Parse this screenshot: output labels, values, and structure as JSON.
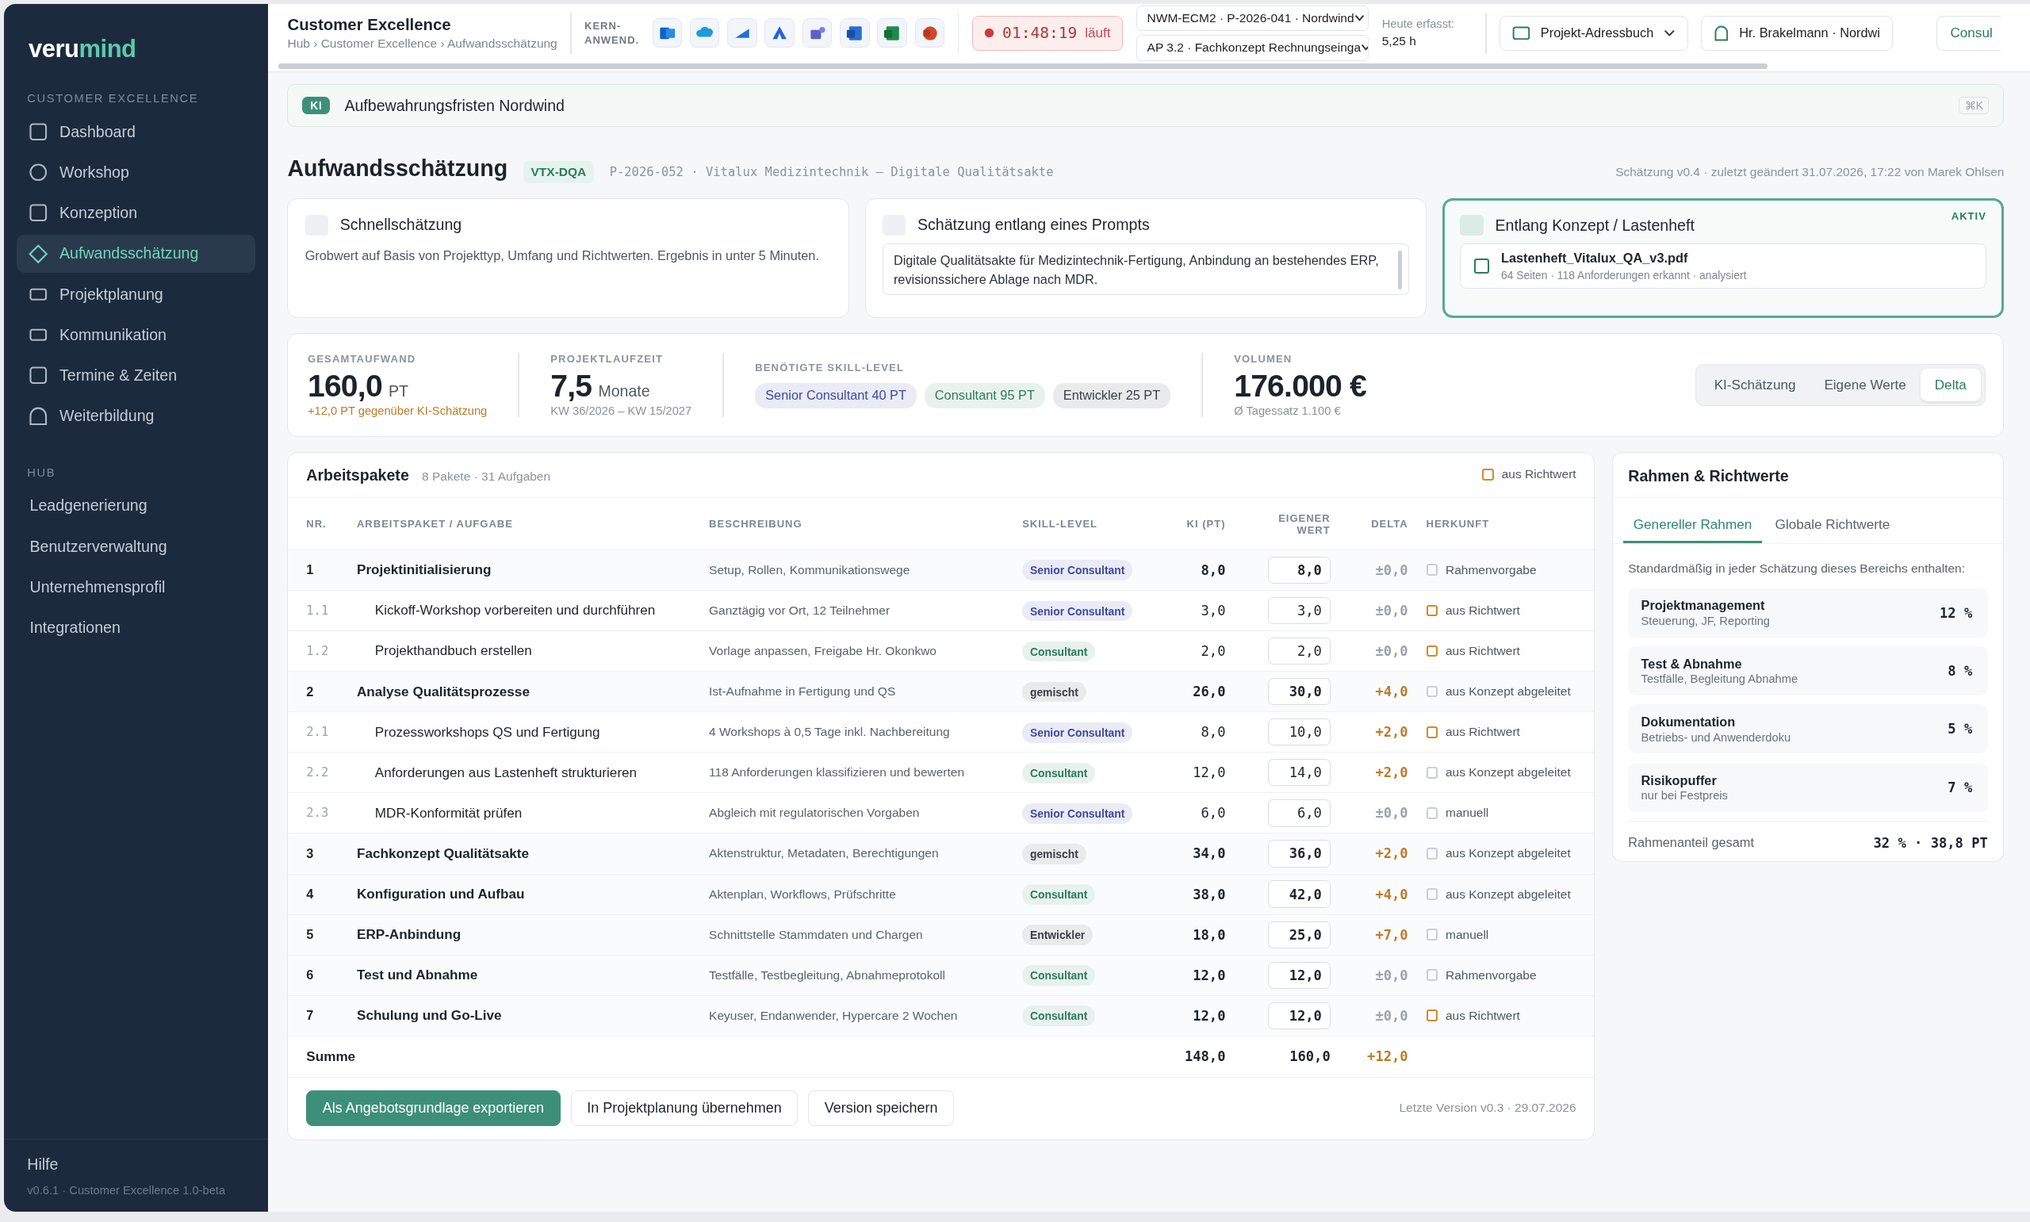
{
  "sidebar": {
    "logo": {
      "first": "veru",
      "second": "mind"
    },
    "sections": [
      {
        "title": "CUSTOMER EXCELLENCE",
        "with_icons": true,
        "items": [
          {
            "label": "Dashboard",
            "selected": false
          },
          {
            "label": "Workshop",
            "selected": false
          },
          {
            "label": "Konzeption",
            "selected": false
          },
          {
            "label": "Aufwandsschätzung",
            "selected": true
          },
          {
            "label": "Projektplanung",
            "selected": false
          },
          {
            "label": "Kommunikation",
            "selected": false
          },
          {
            "label": "Termine & Zeiten",
            "selected": false
          },
          {
            "label": "Weiterbildung",
            "selected": false
          }
        ]
      },
      {
        "title": "HUB",
        "with_icons": false,
        "items": [
          {
            "label": "Leadgenerierung",
            "selected": false
          },
          {
            "label": "Benutzerverwaltung",
            "selected": false
          },
          {
            "label": "Unternehmensprofil",
            "selected": false
          },
          {
            "label": "Integrationen",
            "selected": false
          }
        ]
      }
    ],
    "help": "Hilfe",
    "version": "v0.6.1 · Customer Excellence 1.0-beta"
  },
  "topbar": {
    "title": "Customer Excellence",
    "breadcrumb": "Hub › Customer Excellence › Aufwandsschätzung",
    "apps_label": [
      "KERN-",
      "ANWEND."
    ],
    "timer": {
      "time": "01:48:19",
      "status": "läuft"
    },
    "selects": [
      "NWM-ECM2 · P-2026-041 · Nordwind",
      "AP 3.2 · Fachkonzept Rechnungseinga"
    ],
    "today_label": "Heute erfasst:",
    "today_value": "5,25 h",
    "address_book": "Projekt-Adressbuch",
    "person": "Hr. Brakelmann · Nordwi",
    "cut_button": "Consul"
  },
  "search": {
    "badge": "KI",
    "value": "Aufbewahrungsfristen Nordwind",
    "shortcut": "⌘K"
  },
  "header": {
    "title": "Aufwandsschätzung",
    "tag": "VTX-DQA",
    "project": "P-2026-052 · Vitalux Medizintechnik – Digitale Qualitätsakte",
    "meta": "Schätzung v0.4 · zuletzt geändert 31.07.2026, 17:22 von Marek Ohlsen"
  },
  "modes": [
    {
      "kind": "text",
      "title": "Schnellschätzung",
      "selected": false,
      "text": "Grobwert auf Basis von Projekttyp, Umfang und Richtwerten. Ergebnis in unter 5 Minuten."
    },
    {
      "kind": "prompt",
      "title": "Schätzung entlang eines Prompts",
      "selected": false,
      "text": "Digitale Qualitätsakte für Medizintechnik-Fertigung, Anbindung an bestehendes ERP, revisionssichere Ablage nach MDR."
    },
    {
      "kind": "file",
      "title": "Entlang Konzept / Lastenheft",
      "selected": true,
      "badge": "AKTIV",
      "file": "Lastenheft_Vitalux_QA_v3.pdf",
      "file_meta": "64 Seiten · 118 Anforderungen erkannt · analysiert"
    }
  ],
  "summary": {
    "total": {
      "label": "GESAMTAUFWAND",
      "value": "160,0",
      "unit": "PT",
      "note": "+12,0 PT gegenüber KI-Schätzung"
    },
    "duration": {
      "label": "PROJEKTLAUFZEIT",
      "value": "7,5",
      "unit": "Monate",
      "note": "KW 36/2026 – KW 15/2027"
    },
    "skills": {
      "label": "BENÖTIGTE SKILL-LEVEL",
      "chips": [
        {
          "label": "Senior Consultant 40 PT",
          "color": "#3d4aa3"
        },
        {
          "label": "Consultant 95 PT",
          "color": "#2a7d5b"
        },
        {
          "label": "Entwickler 25 PT",
          "color": "#3a3f47"
        }
      ]
    },
    "volume": {
      "label": "VOLUMEN",
      "value": "176.000 €",
      "note": "Ø Tagessatz 1.100 €"
    },
    "views": [
      {
        "label": "KI-Schätzung",
        "selected": false
      },
      {
        "label": "Eigene Werte",
        "selected": false
      },
      {
        "label": "Delta",
        "selected": true
      }
    ]
  },
  "table": {
    "title": "Arbeitspakete",
    "count": "8 Pakete · 31 Aufgaben",
    "legend": {
      "label": "aus Richtwert",
      "color": "#d18a2c"
    },
    "columns": [
      "NR.",
      "ARBEITSPAKET / AUFGABE",
      "BESCHREIBUNG",
      "SKILL-LEVEL",
      "KI (PT)",
      "EIGENER WERT",
      "DELTA",
      "HERKUNFT"
    ],
    "rows": [
      {
        "nr": "1",
        "title": "Projektinitialisierung",
        "description": "Setup, Rollen, Kommunikationswege",
        "skill": {
          "label": "Senior Consultant",
          "color": "#3d4aa3"
        },
        "ki": "8,0",
        "own": "8,0",
        "delta": "±0,0",
        "delta_changed": false,
        "origin": {
          "label": "Rahmenvorgabe",
          "color": "#c9ced6"
        },
        "children": [
          {
            "nr": "1.1",
            "title": "Kickoff-Workshop vorbereiten und durchführen",
            "description": "Ganztägig vor Ort, 12 Teilnehmer",
            "skill": {
              "label": "Senior Consultant",
              "color": "#3d4aa3"
            },
            "ki": "3,0",
            "own": "3,0",
            "delta": "±0,0",
            "delta_changed": false,
            "origin": {
              "label": "aus Richtwert",
              "color": "#d18a2c"
            }
          },
          {
            "nr": "1.2",
            "title": "Projekthandbuch erstellen",
            "description": "Vorlage anpassen, Freigabe Hr. Okonkwo",
            "skill": {
              "label": "Consultant",
              "color": "#2a7d5b"
            },
            "ki": "2,0",
            "own": "2,0",
            "delta": "±0,0",
            "delta_changed": false,
            "origin": {
              "label": "aus Richtwert",
              "color": "#d18a2c"
            }
          }
        ]
      },
      {
        "nr": "2",
        "title": "Analyse Qualitätsprozesse",
        "description": "Ist-Aufnahme in Fertigung und QS",
        "skill": {
          "label": "gemischt",
          "color": "#3a3f47"
        },
        "ki": "26,0",
        "own": "30,0",
        "delta": "+4,0",
        "delta_changed": true,
        "origin": {
          "label": "aus Konzept abgeleitet",
          "color": "#c9ced6"
        },
        "children": [
          {
            "nr": "2.1",
            "title": "Prozessworkshops QS und Fertigung",
            "description": "4 Workshops à 0,5 Tage inkl. Nachbereitung",
            "skill": {
              "label": "Senior Consultant",
              "color": "#3d4aa3"
            },
            "ki": "8,0",
            "own": "10,0",
            "delta": "+2,0",
            "delta_changed": true,
            "origin": {
              "label": "aus Richtwert",
              "color": "#d18a2c"
            }
          },
          {
            "nr": "2.2",
            "title": "Anforderungen aus Lastenheft strukturieren",
            "description": "118 Anforderungen klassifizieren und bewerten",
            "skill": {
              "label": "Consultant",
              "color": "#2a7d5b"
            },
            "ki": "12,0",
            "own": "14,0",
            "delta": "+2,0",
            "delta_changed": true,
            "origin": {
              "label": "aus Konzept abgeleitet",
              "color": "#c9ced6"
            }
          },
          {
            "nr": "2.3",
            "title": "MDR-Konformität prüfen",
            "description": "Abgleich mit regulatorischen Vorgaben",
            "skill": {
              "label": "Senior Consultant",
              "color": "#3d4aa3"
            },
            "ki": "6,0",
            "own": "6,0",
            "delta": "±0,0",
            "delta_changed": false,
            "origin": {
              "label": "manuell",
              "color": "#c9ced6"
            }
          }
        ]
      },
      {
        "nr": "3",
        "title": "Fachkonzept Qualitätsakte",
        "description": "Aktenstruktur, Metadaten, Berechtigungen",
        "skill": {
          "label": "gemischt",
          "color": "#3a3f47"
        },
        "ki": "34,0",
        "own": "36,0",
        "delta": "+2,0",
        "delta_changed": true,
        "origin": {
          "label": "aus Konzept abgeleitet",
          "color": "#c9ced6"
        }
      },
      {
        "nr": "4",
        "title": "Konfiguration und Aufbau",
        "description": "Aktenplan, Workflows, Prüfschritte",
        "skill": {
          "label": "Consultant",
          "color": "#2a7d5b"
        },
        "ki": "38,0",
        "own": "42,0",
        "delta": "+4,0",
        "delta_changed": true,
        "origin": {
          "label": "aus Konzept abgeleitet",
          "color": "#c9ced6"
        }
      },
      {
        "nr": "5",
        "title": "ERP-Anbindung",
        "description": "Schnittstelle Stammdaten und Chargen",
        "skill": {
          "label": "Entwickler",
          "color": "#3a3f47"
        },
        "ki": "18,0",
        "own": "25,0",
        "delta": "+7,0",
        "delta_changed": true,
        "origin": {
          "label": "manuell",
          "color": "#c9ced6"
        }
      },
      {
        "nr": "6",
        "title": "Test und Abnahme",
        "description": "Testfälle, Testbegleitung, Abnahmeprotokoll",
        "skill": {
          "label": "Consultant",
          "color": "#2a7d5b"
        },
        "ki": "12,0",
        "own": "12,0",
        "delta": "±0,0",
        "delta_changed": false,
        "origin": {
          "label": "Rahmenvorgabe",
          "color": "#c9ced6"
        }
      },
      {
        "nr": "7",
        "title": "Schulung und Go-Live",
        "description": "Keyuser, Endanwender, Hypercare 2 Wochen",
        "skill": {
          "label": "Consultant",
          "color": "#2a7d5b"
        },
        "ki": "12,0",
        "own": "12,0",
        "delta": "±0,0",
        "delta_changed": false,
        "origin": {
          "label": "aus Richtwert",
          "color": "#d18a2c"
        }
      }
    ],
    "sum": {
      "label": "Summe",
      "ki": "148,0",
      "own": "160,0",
      "delta": "+12,0"
    },
    "actions": [
      {
        "label": "Als Angebotsgrundlage exportieren",
        "primary": true
      },
      {
        "label": "In Projektplanung übernehmen",
        "primary": false
      },
      {
        "label": "Version speichern",
        "primary": false
      }
    ],
    "last_version": "Letzte Version v0.3 · 29.07.2026"
  },
  "frame": {
    "title": "Rahmen & Richtwerte",
    "tabs": [
      {
        "label": "Genereller Rahmen",
        "selected": true
      },
      {
        "label": "Globale Richtwerte",
        "selected": false
      }
    ],
    "intro": "Standardmäßig in jeder Schätzung dieses Bereichs enthalten:",
    "items": [
      {
        "name": "Projektmanagement",
        "description": "Steuerung, JF, Reporting",
        "value": "12 %"
      },
      {
        "name": "Test & Abnahme",
        "description": "Testfälle, Begleitung Abnahme",
        "value": "8 %"
      },
      {
        "name": "Dokumentation",
        "description": "Betriebs- und Anwenderdoku",
        "value": "5 %"
      },
      {
        "name": "Risikopuffer",
        "description": "nur bei Festpreis",
        "value": "7 %"
      }
    ],
    "total_label": "Rahmenanteil gesamt",
    "total_value": "32 % · 38,8 PT"
  }
}
